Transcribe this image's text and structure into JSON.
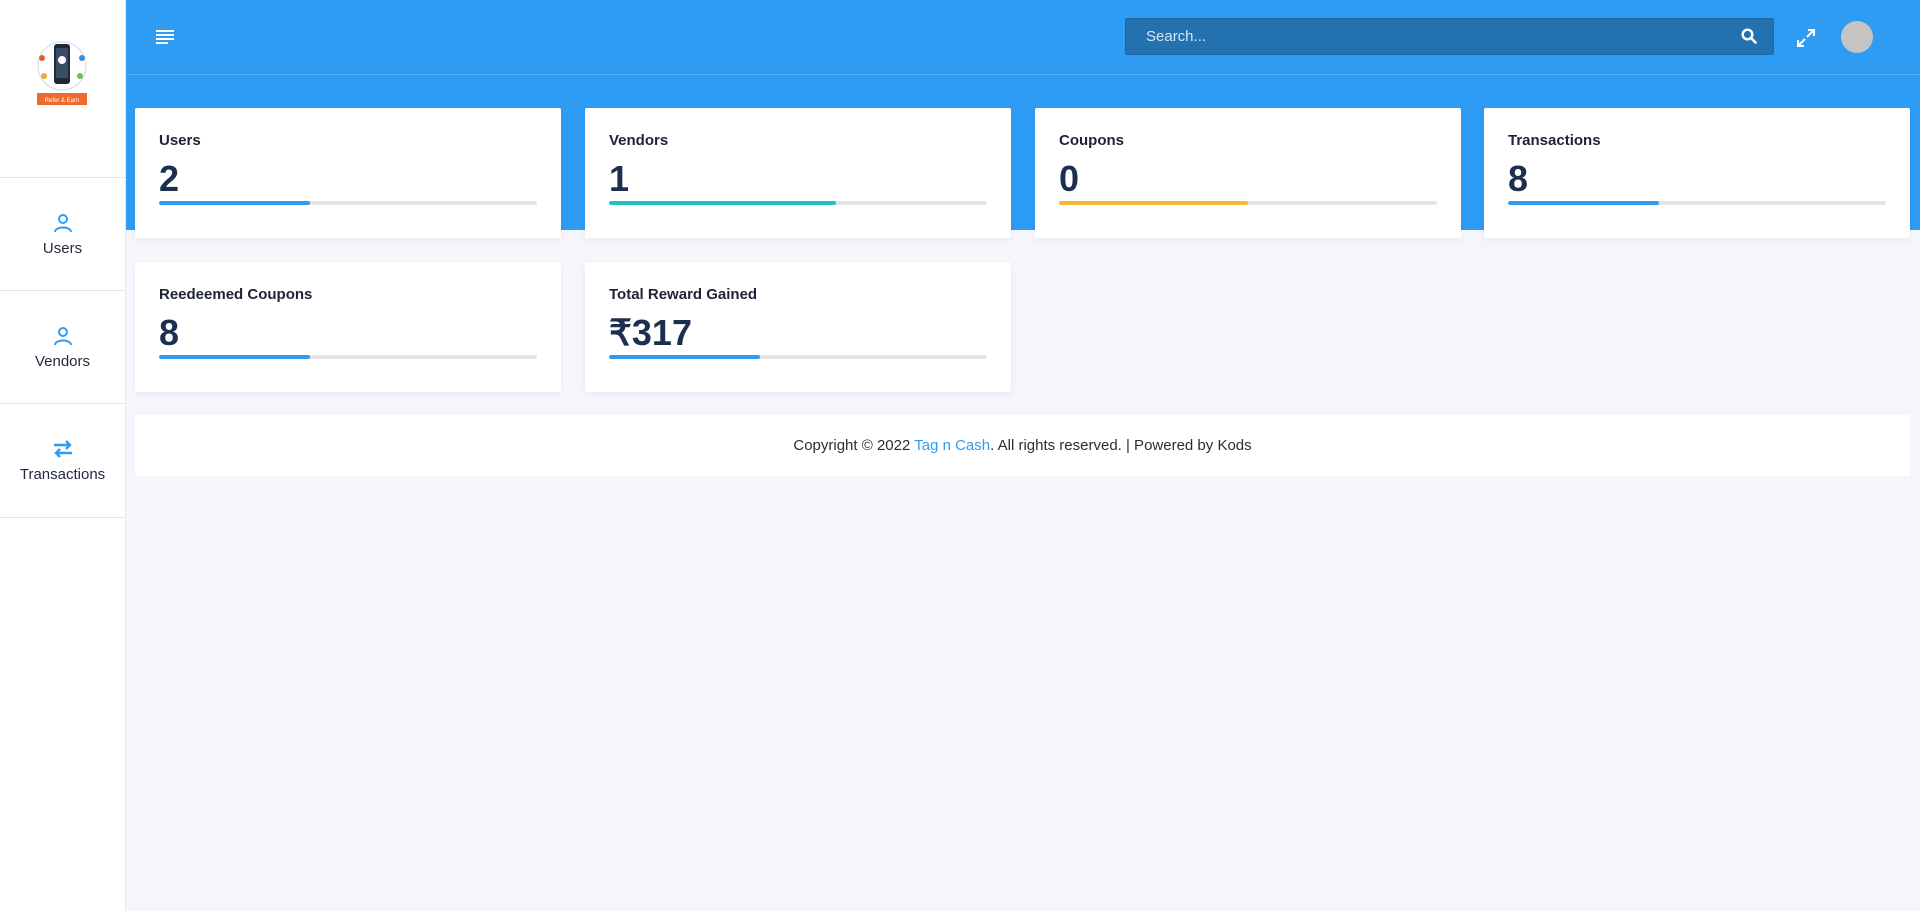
{
  "sidebar": {
    "logo_icon": "refer-and-earn-logo",
    "logo_text": "Refer & Earn",
    "items": [
      {
        "label": "Users",
        "icon": "user-icon"
      },
      {
        "label": "Vendors",
        "icon": "user-icon"
      },
      {
        "label": "Transactions",
        "icon": "transfer-arrows-icon"
      }
    ]
  },
  "header": {
    "menu_icon": "hamburger-menu-icon",
    "search": {
      "placeholder": "Search...",
      "value": ""
    },
    "search_icon": "search-icon",
    "fullscreen_icon": "expand-icon",
    "avatar": "avatar"
  },
  "cards": [
    {
      "title": "Users",
      "value": "2",
      "progress": 0.4,
      "color": "#2f9cf4"
    },
    {
      "title": "Vendors",
      "value": "1",
      "progress": 0.6,
      "color": "#1fc2c1"
    },
    {
      "title": "Coupons",
      "value": "0",
      "progress": 0.5,
      "color": "#f6b82e"
    },
    {
      "title": "Transactions",
      "value": "8",
      "progress": 0.4,
      "color": "#2f9cf4"
    },
    {
      "title": "Reedeemed Coupons",
      "value": "8",
      "progress": 0.4,
      "color": "#2f9cf4"
    },
    {
      "title": "Total Reward Gained",
      "value": "₹317",
      "progress": 0.4,
      "color": "#2f9cf4"
    }
  ],
  "footer": {
    "prefix": "Copyright © 2022 ",
    "link": "Tag n Cash",
    "suffix": ". All rights reserved. | Powered by Kods"
  },
  "colors": {
    "accent": "#2f9cf4",
    "background": "#f6f5fb"
  }
}
